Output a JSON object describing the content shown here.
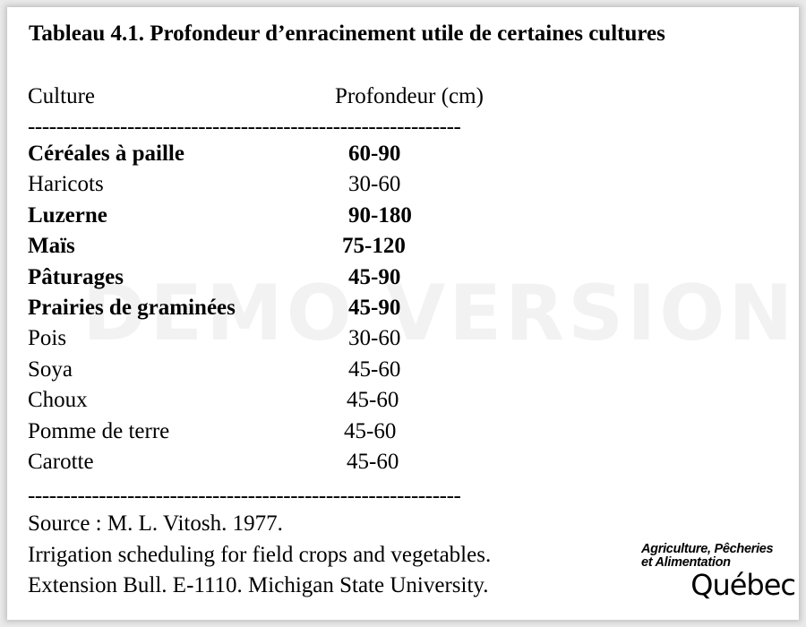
{
  "document": {
    "title": "Tableau 4.1. Profondeur d’enracinement utile de certaines cultures",
    "columns": {
      "culture": "Culture",
      "depth": "Profondeur (cm)"
    },
    "separator": "-------------------------------------------------------------",
    "rows": [
      {
        "culture": "Céréales à paille",
        "depth": "60-90",
        "bold": true
      },
      {
        "culture": "Haricots",
        "depth": "30-60",
        "bold": false
      },
      {
        "culture": "Luzerne",
        "depth": "90-180",
        "bold": true
      },
      {
        "culture": "Maïs",
        "depth": "75-120",
        "bold": true
      },
      {
        "culture": "Pâturages",
        "depth": "45-90",
        "bold": true
      },
      {
        "culture": "Prairies de graminées",
        "depth": "45-90",
        "bold": true
      },
      {
        "culture": "Pois",
        "depth": "30-60",
        "bold": false
      },
      {
        "culture": "Soya",
        "depth": "45-60",
        "bold": false
      },
      {
        "culture": "Choux",
        "depth": "45-60",
        "bold": false
      },
      {
        "culture": "Pomme de terre",
        "depth": "45-60",
        "bold": false
      },
      {
        "culture": "Carotte",
        "depth": "45-60",
        "bold": false
      }
    ],
    "source": [
      "Source : M. L. Vitosh. 1977.",
      "Irrigation scheduling for field crops and vegetables.",
      "Extension Bull. E-1110. Michigan State University."
    ]
  },
  "logo": {
    "line1": "Agriculture, Pêcheries",
    "line2": "et Alimentation",
    "line3": "Québec"
  },
  "watermark": "DEMO VERSION"
}
